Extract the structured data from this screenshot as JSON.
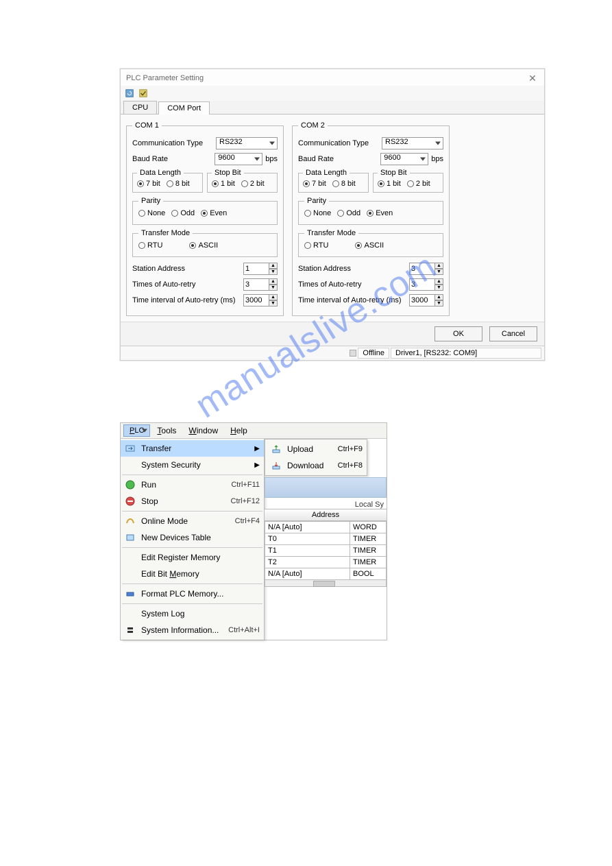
{
  "dialog": {
    "title": "PLC Parameter Setting",
    "tabs": {
      "cpu": "CPU",
      "com_port": "COM Port"
    },
    "buttons": {
      "ok": "OK",
      "cancel": "Cancel"
    },
    "status": {
      "mode": "Offline",
      "driver": "Driver1, [RS232: COM9]"
    }
  },
  "com1": {
    "legend": "COM 1",
    "comm_type_label": "Communication Type",
    "comm_type_value": "RS232",
    "baud_label": "Baud Rate",
    "baud_value": "9600",
    "baud_unit": "bps",
    "data_length_legend": "Data Length",
    "dl_7": "7 bit",
    "dl_8": "8 bit",
    "stop_legend": "Stop Bit",
    "sb_1": "1 bit",
    "sb_2": "2 bit",
    "parity_legend": "Parity",
    "p_none": "None",
    "p_odd": "Odd",
    "p_even": "Even",
    "transfer_legend": "Transfer Mode",
    "t_rtu": "RTU",
    "t_ascii": "ASCII",
    "station_label": "Station Address",
    "station_value": "1",
    "retry_label": "Times of Auto-retry",
    "retry_value": "3",
    "retry_ms_label": "Time interval of Auto-retry (ms)",
    "retry_ms_value": "3000"
  },
  "com2": {
    "legend": "COM 2",
    "comm_type_label": "Communication Type",
    "comm_type_value": "RS232",
    "baud_label": "Baud Rate",
    "baud_value": "9600",
    "baud_unit": "bps",
    "data_length_legend": "Data Length",
    "dl_7": "7 bit",
    "dl_8": "8 bit",
    "stop_legend": "Stop Bit",
    "sb_1": "1 bit",
    "sb_2": "2 bit",
    "parity_legend": "Parity",
    "p_none": "None",
    "p_odd": "Odd",
    "p_even": "Even",
    "transfer_legend": "Transfer Mode",
    "t_rtu": "RTU",
    "t_ascii": "ASCII",
    "station_label": "Station Address",
    "station_value": "3",
    "retry_label": "Times of Auto-retry",
    "retry_value": "3",
    "retry_ms_label": "Time interval of Auto-retry (ms)",
    "retry_ms_value": "3000"
  },
  "menubar": {
    "plc": "PLC",
    "tools": "Tools",
    "window": "Window",
    "help": "Help"
  },
  "plc_menu": {
    "transfer": "Transfer",
    "system_security": "System Security",
    "run": "Run",
    "run_sc": "Ctrl+F11",
    "stop": "Stop",
    "stop_sc": "Ctrl+F12",
    "online_mode": "Online Mode",
    "online_sc": "Ctrl+F4",
    "new_devices_table": "New Devices Table",
    "edit_register_memory": "Edit Register Memory",
    "edit_bit_memory": "Edit Bit Memory",
    "format_plc_memory": "Format PLC Memory...",
    "system_log": "System Log",
    "system_info": "System Information...",
    "system_info_sc": "Ctrl+Alt+I"
  },
  "transfer_flyout": {
    "upload": "Upload",
    "upload_sc": "Ctrl+F9",
    "download": "Download",
    "download_sc": "Ctrl+F8"
  },
  "grid": {
    "local_sy": "Local Sy",
    "address_hdr": "Address",
    "rows": [
      {
        "addr": "N/A [Auto]",
        "type": "WORD"
      },
      {
        "addr": "T0",
        "type": "TIMER"
      },
      {
        "addr": "T1",
        "type": "TIMER"
      },
      {
        "addr": "T2",
        "type": "TIMER"
      },
      {
        "addr": "N/A [Auto]",
        "type": "BOOL"
      }
    ]
  },
  "watermark": "manualslive.com"
}
